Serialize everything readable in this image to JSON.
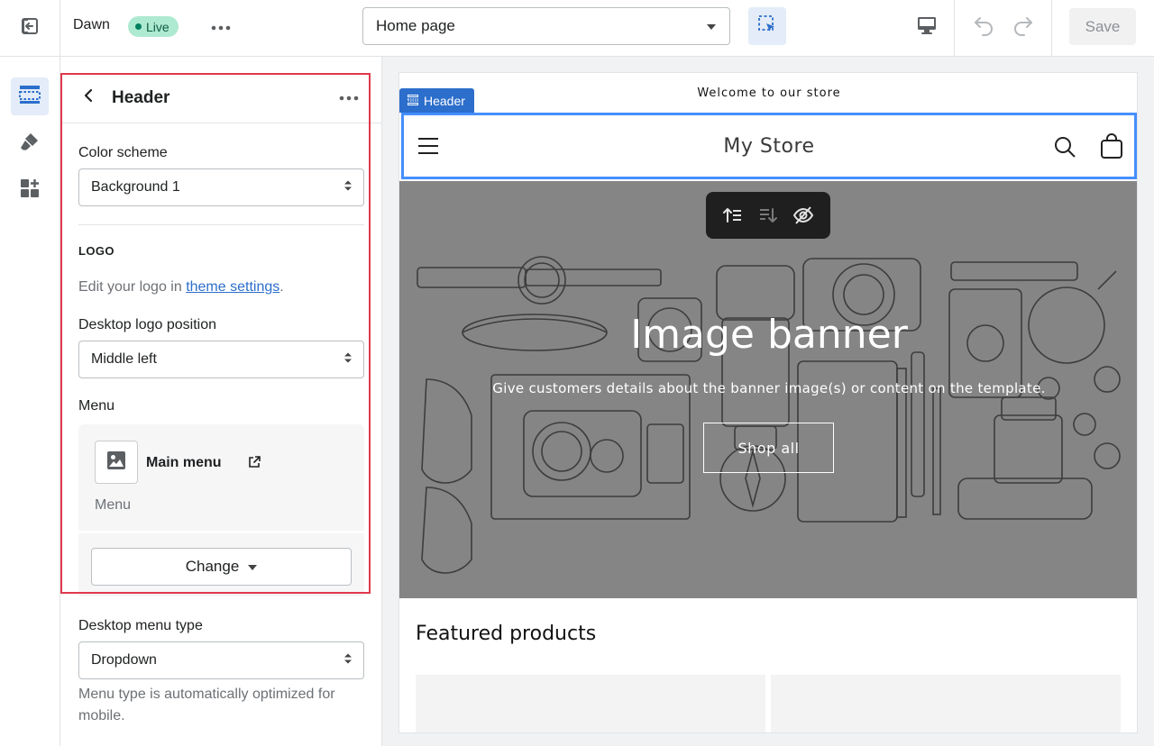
{
  "topbar": {
    "theme_name": "Dawn",
    "live_label": "Live",
    "page_selector": "Home page",
    "save_label": "Save"
  },
  "panel": {
    "title": "Header",
    "color_scheme_label": "Color scheme",
    "color_scheme_value": "Background 1",
    "logo_heading": "LOGO",
    "logo_help_prefix": "Edit your logo in ",
    "logo_help_link": "theme settings",
    "logo_help_suffix": ".",
    "logo_position_label": "Desktop logo position",
    "logo_position_value": "Middle left",
    "menu_label": "Menu",
    "menu_name": "Main menu",
    "menu_sub": "Menu",
    "change_label": "Change",
    "menu_type_label": "Desktop menu type",
    "menu_type_value": "Dropdown",
    "menu_type_help": "Menu type is automatically optimized for mobile."
  },
  "preview": {
    "announcement": "Welcome to our store",
    "header_tag": "Header",
    "store_name": "My Store",
    "banner_title": "Image banner",
    "banner_subtitle": "Give customers details about the banner image(s) or content on the template.",
    "banner_button": "Shop all",
    "featured_title": "Featured products"
  },
  "colors": {
    "accent": "#2c6ecb",
    "live_badge": "#aee9d1",
    "highlight": "#e0394d",
    "banner_overlay": "#858585"
  },
  "icons": {
    "exit": "exit-icon",
    "more": "more-horizontal-icon",
    "inspector": "select-cursor-icon",
    "desktop": "desktop-icon",
    "undo": "undo-icon",
    "redo": "redo-icon",
    "sections": "sections-icon",
    "theme_settings": "brush-icon",
    "apps": "apps-icon"
  }
}
